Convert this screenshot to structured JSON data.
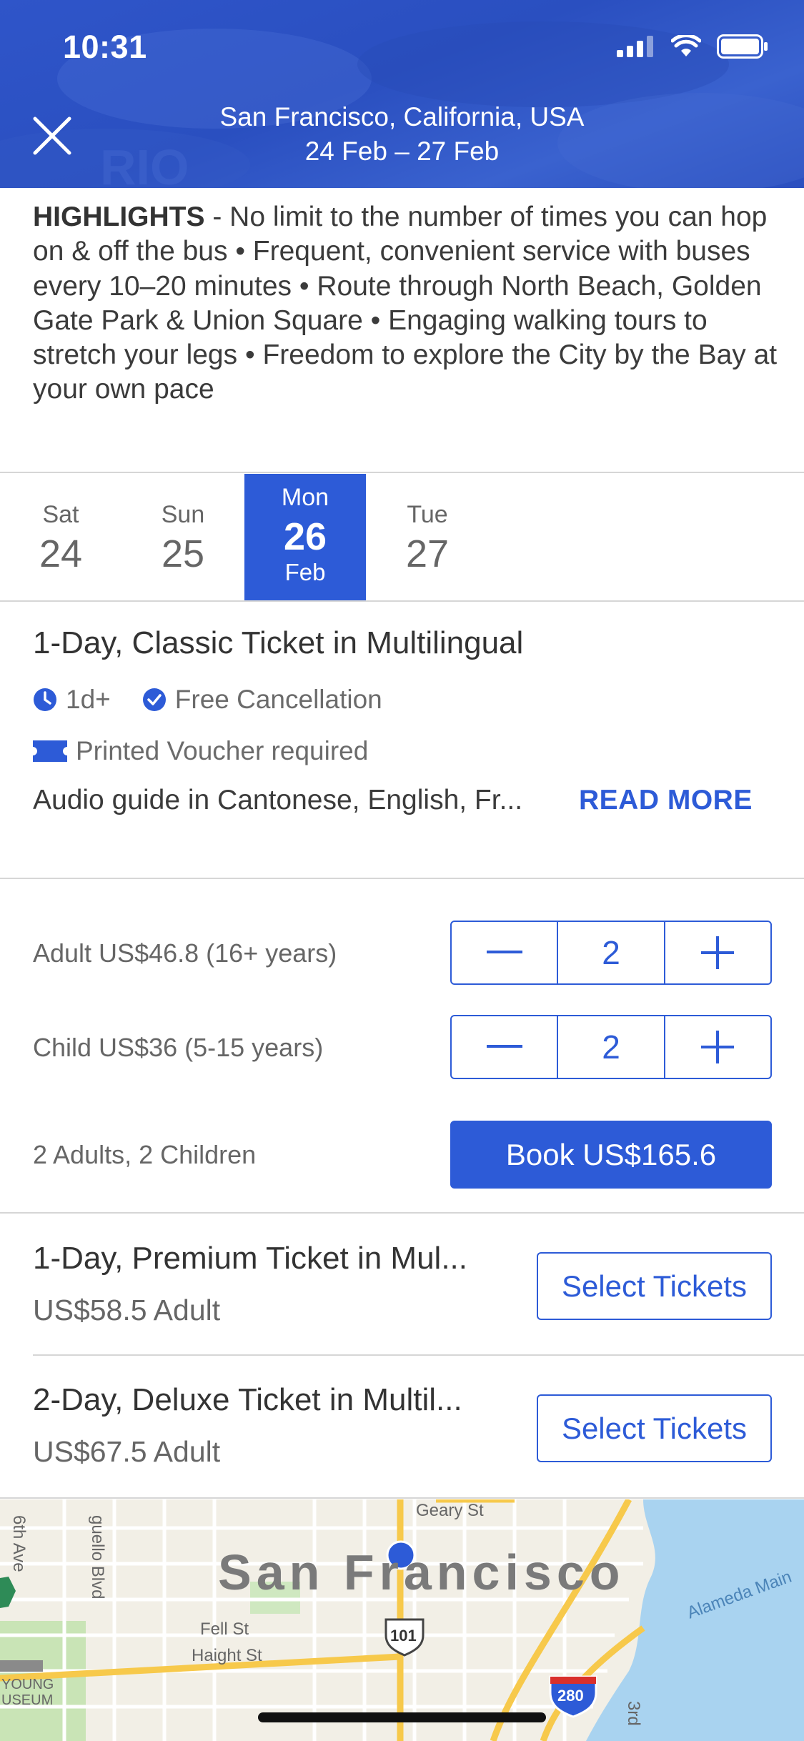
{
  "status_bar": {
    "time": "10:31"
  },
  "header": {
    "location": "San Francisco, California, USA",
    "dates": "24 Feb – 27 Feb"
  },
  "highlights": {
    "label": "HIGHLIGHTS",
    "text": " - No limit to the number of times you can hop on & off the bus • Frequent, convenient service with buses every 10–20 minutes • Route through North Beach, Golden Gate Park & Union Square • Engaging walking tours to stretch your legs • Freedom to explore the City by the Bay at your own pace"
  },
  "dates": [
    {
      "dow": "Sat",
      "day": "24"
    },
    {
      "dow": "Sun",
      "day": "25"
    },
    {
      "dow": "Mon",
      "day": "26",
      "month": "Feb",
      "selected": true
    },
    {
      "dow": "Tue",
      "day": "27"
    }
  ],
  "ticket": {
    "title": "1-Day, Classic Ticket in Multilingual",
    "duration": "1d+",
    "cancellation": "Free Cancellation",
    "voucher": "Printed Voucher required",
    "audio": "Audio guide in Cantonese, English, Fr...",
    "read_more": "READ MORE"
  },
  "quantities": {
    "adult": {
      "label": "Adult US$46.8 (16+ years)",
      "value": "2"
    },
    "child": {
      "label": "Child US$36 (5-15 years)",
      "value": "2"
    },
    "summary": "2 Adults, 2 Children",
    "book_label": "Book US$165.6"
  },
  "other_tickets": [
    {
      "title": "1-Day, Premium Ticket in Mul...",
      "price": "US$58.5 Adult",
      "button": "Select Tickets"
    },
    {
      "title": "2-Day, Deluxe Ticket in Multil...",
      "price": "US$67.5 Adult",
      "button": "Select Tickets"
    }
  ],
  "map": {
    "city": "San Francisco",
    "labels": {
      "sixth_ave": "6th Ave",
      "arguello": "guello Blvd",
      "geary": "Geary St",
      "fell": "Fell St",
      "haight": "Haight St",
      "alameda": "Alameda Main",
      "young": "YOUNG",
      "museum": "USEUM",
      "third": "3rd",
      "hwy101": "101",
      "hwy280": "280"
    }
  },
  "colors": {
    "accent": "#2d5bd7",
    "header": "#2f55c9",
    "water": "#a9d3f0",
    "road": "#f7c94b"
  }
}
